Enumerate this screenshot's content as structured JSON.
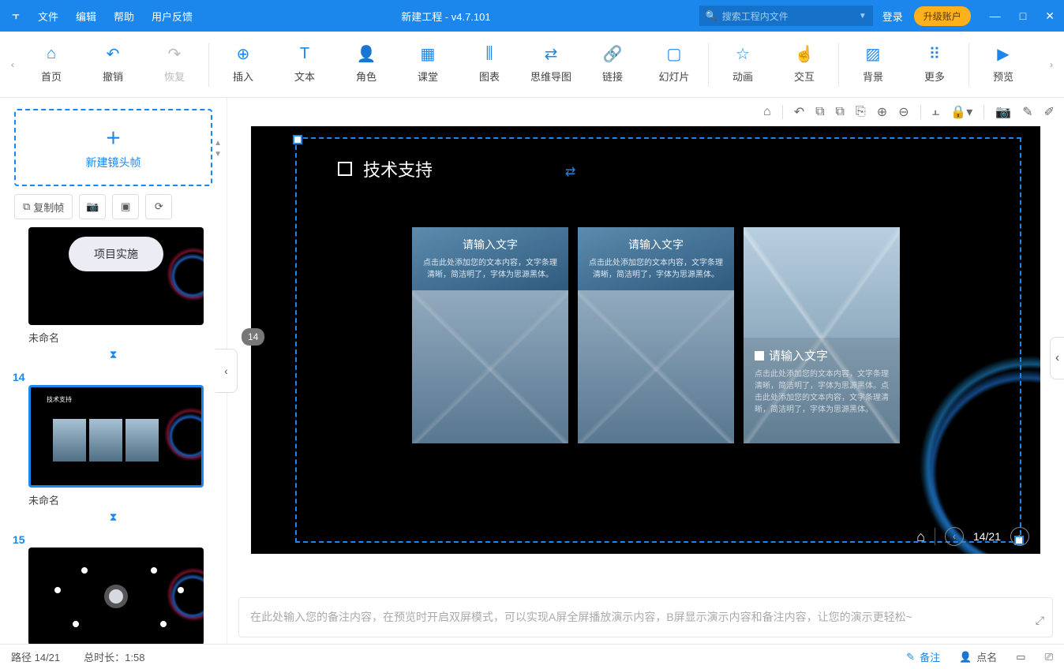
{
  "titlebar": {
    "menus": [
      "文件",
      "编辑",
      "帮助",
      "用户反馈"
    ],
    "center": "新建工程 - v4.7.101",
    "search_placeholder": "搜索工程内文件",
    "login": "登录",
    "upgrade": "升级账户"
  },
  "toolbar": {
    "items": [
      {
        "icon": "⌂",
        "label": "首页"
      },
      {
        "icon": "↶",
        "label": "撤销"
      },
      {
        "icon": "↷",
        "label": "恢复",
        "disabled": true
      },
      {
        "sep": true
      },
      {
        "icon": "⊕",
        "label": "插入"
      },
      {
        "icon": "T",
        "label": "文本"
      },
      {
        "icon": "👤",
        "label": "角色"
      },
      {
        "icon": "▦",
        "label": "课堂"
      },
      {
        "icon": "⫼",
        "label": "图表"
      },
      {
        "icon": "⇄",
        "label": "思维导图"
      },
      {
        "icon": "🔗",
        "label": "链接"
      },
      {
        "icon": "▢",
        "label": "幻灯片"
      },
      {
        "sep": true
      },
      {
        "icon": "☆",
        "label": "动画"
      },
      {
        "icon": "☝",
        "label": "交互"
      },
      {
        "sep": true
      },
      {
        "icon": "▨",
        "label": "背景"
      },
      {
        "icon": "⠿",
        "label": "更多"
      },
      {
        "sep": true
      },
      {
        "icon": "▶",
        "label": "预览"
      }
    ]
  },
  "sidebar": {
    "newframe": "新建镜头帧",
    "copy": "复制帧",
    "thumbs": [
      {
        "num": "",
        "label": "未命名",
        "title": "项目实施",
        "variant": "pill"
      },
      {
        "num": "14",
        "label": "未命名",
        "title": "技术支持",
        "variant": "cards",
        "selected": true
      },
      {
        "num": "15",
        "label": "",
        "title": "",
        "variant": "mindmap"
      }
    ]
  },
  "canvas_toolbar_icons": [
    "⌂",
    "↶",
    "⧉",
    "⧉",
    "⎘",
    "⊕",
    "⊖",
    "",
    "⫠",
    "🔒",
    "",
    "📷",
    "✎",
    "✎"
  ],
  "slide": {
    "badge": "14",
    "title": "技术支持",
    "cards": [
      {
        "h": "请输入文字",
        "p": "点击此处添加您的文本内容，文字条理清晰，简洁明了，字体为思源黑体。"
      },
      {
        "h": "请输入文字",
        "p": "点击此处添加您的文本内容，文字条理清晰，简洁明了，字体为思源黑体。"
      },
      {
        "h": "请输入文字",
        "p": "点击此处添加您的文本内容，文字条理清晰，简洁明了，字体为思源黑体。点击此处添加您的文本内容，文字条理清晰，简洁明了，字体为思源黑体。"
      }
    ],
    "index": "14/21"
  },
  "notes_placeholder": "在此处输入您的备注内容，在预览时开启双屏模式，可以实现A屏全屏播放演示内容，B屏显示演示内容和备注内容，让您的演示更轻松~",
  "statusbar": {
    "path": "路径 14/21",
    "duration": "总时长：1:58",
    "notes": "备注",
    "roll": "点名"
  }
}
